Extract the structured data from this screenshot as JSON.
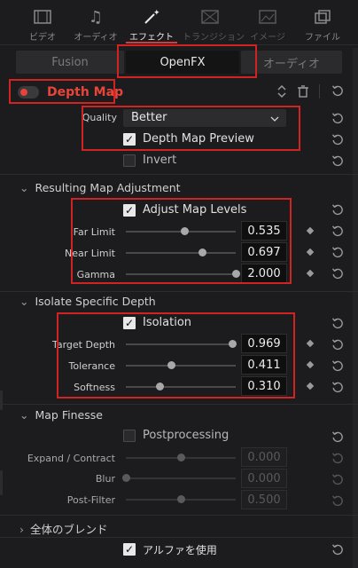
{
  "tabs": [
    {
      "label": "ビデオ",
      "icon": "video-icon",
      "state": "normal"
    },
    {
      "label": "オーディオ",
      "icon": "audio-icon",
      "state": "normal"
    },
    {
      "label": "エフェクト",
      "icon": "magic-wand-icon",
      "state": "active"
    },
    {
      "label": "トランジション",
      "icon": "transition-icon",
      "state": "dim"
    },
    {
      "label": "イメージ",
      "icon": "image-icon",
      "state": "dim"
    },
    {
      "label": "ファイル",
      "icon": "file-icon",
      "state": "normal"
    }
  ],
  "segments": [
    {
      "label": "Fusion",
      "active": false
    },
    {
      "label": "OpenFX",
      "active": true
    },
    {
      "label": "オーディオ",
      "active": false
    }
  ],
  "effect": {
    "title": "Depth Map",
    "enabled": true
  },
  "quality": {
    "label": "Quality",
    "value": "Better"
  },
  "checks": {
    "preview": {
      "label": "Depth Map Preview",
      "checked": true
    },
    "invert": {
      "label": "Invert",
      "checked": false
    },
    "adjust": {
      "label": "Adjust Map Levels",
      "checked": true
    },
    "isolation": {
      "label": "Isolation",
      "checked": true
    },
    "postprocessing": {
      "label": "Postprocessing",
      "checked": false
    },
    "alpha": {
      "label": "アルファを使用",
      "checked": true
    }
  },
  "sections": {
    "resulting": "Resulting Map Adjustment",
    "isolate": "Isolate Specific Depth",
    "finesse": "Map Finesse",
    "blend": "全体のブレンド"
  },
  "params": {
    "far_limit": {
      "label": "Far Limit",
      "value": "0.535",
      "level": 0.535
    },
    "near_limit": {
      "label": "Near Limit",
      "value": "0.697",
      "level": 0.697
    },
    "gamma": {
      "label": "Gamma",
      "value": "2.000",
      "level": 1.0
    },
    "target_depth": {
      "label": "Target Depth",
      "value": "0.969",
      "level": 0.969
    },
    "tolerance": {
      "label": "Tolerance",
      "value": "0.411",
      "level": 0.411
    },
    "softness": {
      "label": "Softness",
      "value": "0.310",
      "level": 0.31
    },
    "expand": {
      "label": "Expand / Contract",
      "value": "0.000",
      "level": 0.5
    },
    "blur": {
      "label": "Blur",
      "value": "0.000",
      "level": 0.0
    },
    "post_filter": {
      "label": "Post-Filter",
      "value": "0.500",
      "level": 0.5
    }
  },
  "colors": {
    "accent": "#d83b3b",
    "highlight_box": "#d22323"
  }
}
